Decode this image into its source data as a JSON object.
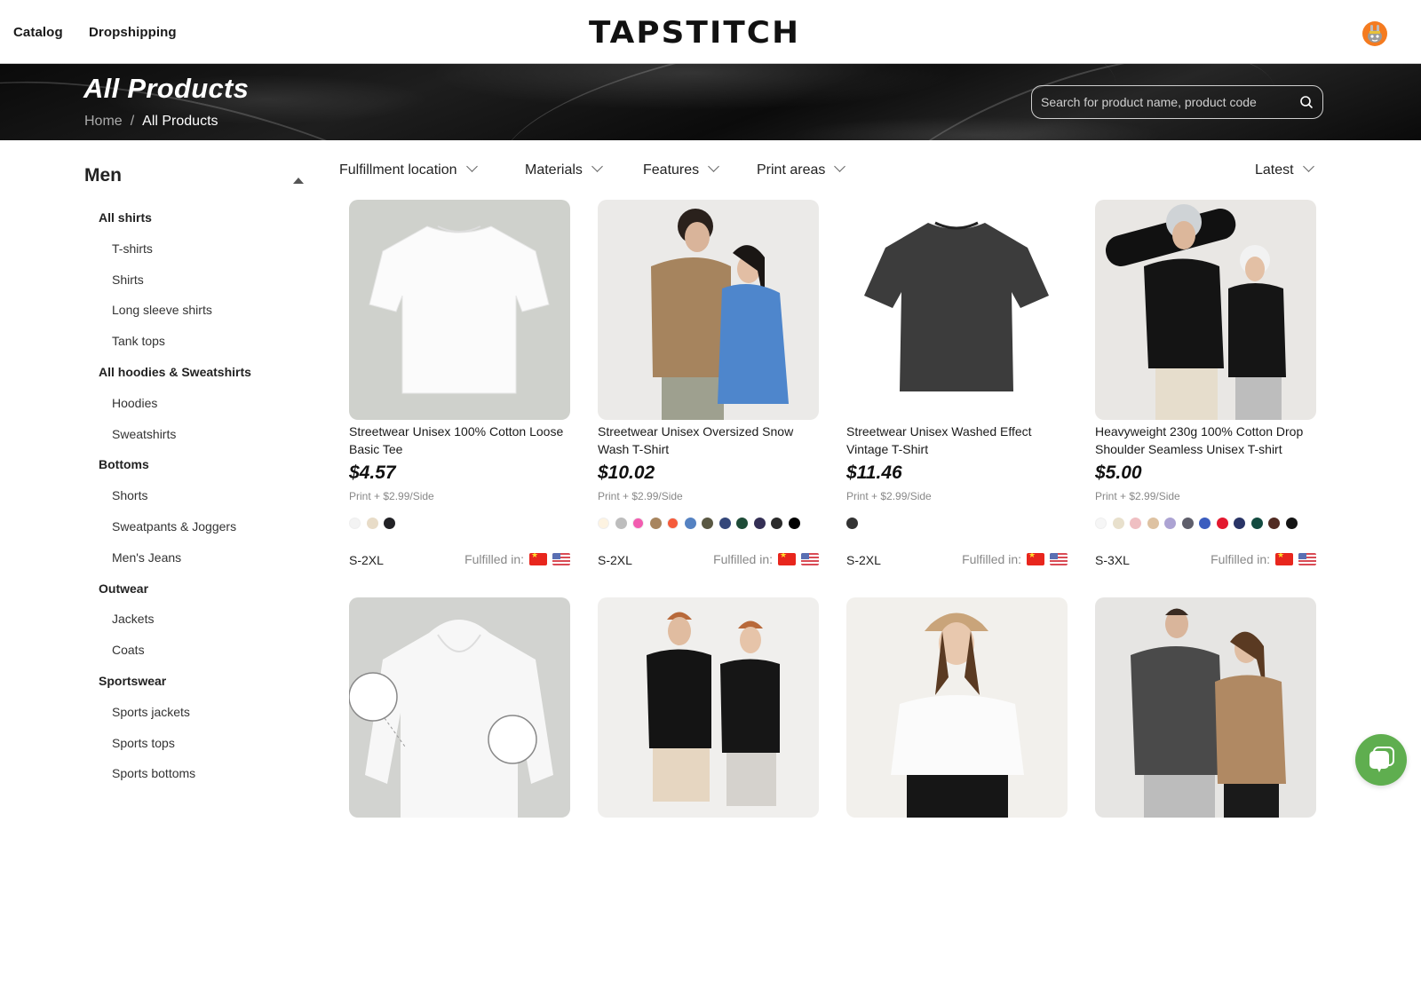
{
  "topnav": {
    "links": [
      "Catalog",
      "Dropshipping"
    ],
    "logo": "TAPSTITCH",
    "avatar_color": "#f47b20"
  },
  "banner": {
    "title": "All Products",
    "breadcrumb": {
      "home": "Home",
      "separator": "/",
      "current": "All Products"
    },
    "search": {
      "placeholder": "Search for product name, product code",
      "value": ""
    }
  },
  "sidebar": {
    "title": "Men",
    "items": [
      {
        "label": "All shirts",
        "level": "cat"
      },
      {
        "label": "T-shirts",
        "level": "sub"
      },
      {
        "label": "Shirts",
        "level": "sub"
      },
      {
        "label": "Long sleeve shirts",
        "level": "sub"
      },
      {
        "label": "Tank tops",
        "level": "sub"
      },
      {
        "label": "All hoodies & Sweatshirts",
        "level": "cat"
      },
      {
        "label": "Hoodies",
        "level": "sub"
      },
      {
        "label": "Sweatshirts",
        "level": "sub"
      },
      {
        "label": "Bottoms",
        "level": "cat"
      },
      {
        "label": "Shorts",
        "level": "sub"
      },
      {
        "label": "Sweatpants & Joggers",
        "level": "sub"
      },
      {
        "label": "Men's Jeans",
        "level": "sub"
      },
      {
        "label": "Outwear",
        "level": "cat"
      },
      {
        "label": "Jackets",
        "level": "sub"
      },
      {
        "label": "Coats",
        "level": "sub"
      },
      {
        "label": "Sportswear",
        "level": "cat"
      },
      {
        "label": "Sports jackets",
        "level": "sub"
      },
      {
        "label": "Sports tops",
        "level": "sub"
      },
      {
        "label": "Sports bottoms",
        "level": "sub"
      }
    ]
  },
  "filters": {
    "items": [
      "Fulfillment location",
      "Materials",
      "Features",
      "Print areas"
    ],
    "sort": "Latest"
  },
  "products": [
    {
      "name": "Streetwear Unisex 100% Cotton Loose Basic Tee",
      "price": "$4.57",
      "print": "Print + $2.99/Side",
      "colors": [
        "#f3f3f3",
        "#e8dcc8",
        "#222226"
      ],
      "sizes": "S-2XL",
      "fulfilled_label": "Fulfilled in:",
      "fulfilled": [
        "CN",
        "US"
      ],
      "image": "white-tee"
    },
    {
      "name": "Streetwear Unisex Oversized Snow Wash T-Shirt",
      "price": "$10.02",
      "print": "Print + $2.99/Side",
      "colors": [
        "#fdf3e1",
        "#bdbdbd",
        "#f25cb0",
        "#a8855f",
        "#f55b3b",
        "#5582c2",
        "#5a5843",
        "#34477a",
        "#1e4c38",
        "#342f55",
        "#2b2b2b",
        "#000000"
      ],
      "sizes": "S-2XL",
      "fulfilled_label": "Fulfilled in:",
      "fulfilled": [
        "CN",
        "US"
      ],
      "image": "models-snow-wash"
    },
    {
      "name": "Streetwear Unisex Washed Effect Vintage T-Shirt",
      "price": "$11.46",
      "print": "Print + $2.99/Side",
      "colors": [
        "#333333"
      ],
      "sizes": "S-2XL",
      "fulfilled_label": "Fulfilled in:",
      "fulfilled": [
        "CN",
        "US"
      ],
      "image": "black-washed-tee"
    },
    {
      "name": "Heavyweight 230g 100% Cotton Drop Shoulder Seamless Unisex T-shirt",
      "price": "$5.00",
      "print": "Print + $2.99/Side",
      "colors": [
        "#f6f6f6",
        "#e8e0cc",
        "#efbfc2",
        "#dec2a2",
        "#aca3d3",
        "#5e5e6b",
        "#3b5dbf",
        "#e3182f",
        "#293466",
        "#134b40",
        "#512b22",
        "#141414"
      ],
      "sizes": "S-3XL",
      "fulfilled_label": "Fulfilled in:",
      "fulfilled": [
        "CN",
        "US"
      ],
      "image": "models-skateboard"
    },
    {
      "name": "",
      "image": "white-hoodie"
    },
    {
      "name": "",
      "image": "models-beanie-black-tees"
    },
    {
      "name": "",
      "image": "model-white-tee-cap"
    },
    {
      "name": "",
      "image": "models-grey-hoodies"
    }
  ],
  "chat": {
    "color": "#5fae4f"
  }
}
